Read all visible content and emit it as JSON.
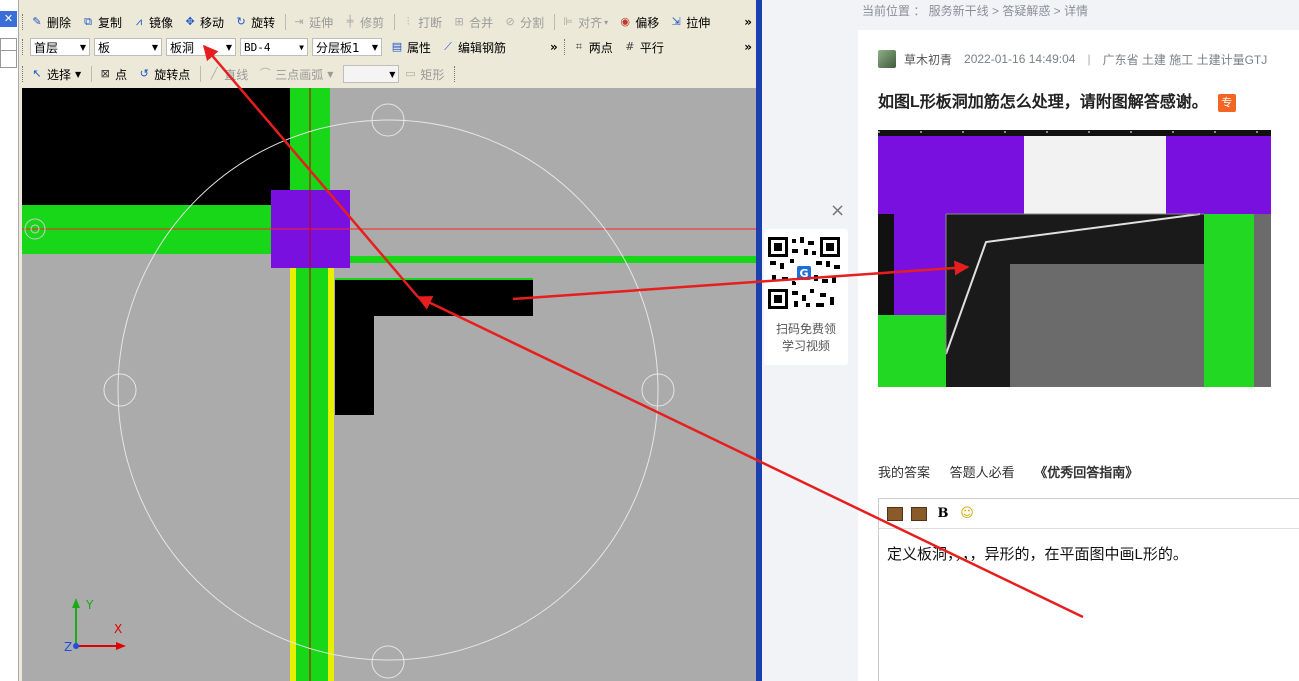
{
  "cad": {
    "toolbar1": {
      "delete": "删除",
      "copy": "复制",
      "mirror": "镜像",
      "move": "移动",
      "rotate": "旋转",
      "extend": "延伸",
      "trim": "修剪",
      "break": "打断",
      "merge": "合并",
      "split": "分割",
      "align": "对齐",
      "offset": "偏移",
      "stretch": "拉伸",
      "more": "»"
    },
    "toolbar2": {
      "floor": "首层",
      "category": "板",
      "component": "板洞",
      "code": "BD-4",
      "layer": "分层板1",
      "properties": "属性",
      "edit_rebar": "编辑钢筋",
      "more": "»",
      "two_point": "两点",
      "parallel": "平行",
      "more2": "»"
    },
    "toolbar3": {
      "select": "选择",
      "point": "点",
      "rotate_point": "旋转点",
      "line": "直线",
      "arc": "三点画弧",
      "rect": "矩形"
    },
    "axis": {
      "y": "Y",
      "x": "X",
      "z": "Z"
    },
    "close_icon": "✕"
  },
  "web": {
    "breadcrumb": "当前位置 ： 服务新干线 > 答疑解惑 > 详情",
    "author": "草木初青",
    "timestamp": "2022-01-16 14:49:04",
    "divider": "|",
    "tags": "广东省  土建 施工 土建计量GTJ",
    "question_title": "如图L形板洞加筋怎么处理，请附图解答感谢。",
    "badge": "专",
    "qr_label_line1": "扫码免费领",
    "qr_label_line2": "学习视频",
    "qr_close": "×",
    "tab_my_answer": "我的答案",
    "tab_must_read": "答题人必看",
    "guide_link": "《优秀回答指南》",
    "editor_bold": "B",
    "answer_text": "定义板洞，，，，异形的，在平面图中画L形的。"
  },
  "colors": {
    "cad_background": "#ababab",
    "green": "#18d618",
    "purple": "#7a10e0",
    "yellow": "#e8f000",
    "annotation_red": "#e61e1e",
    "badge_orange": "#f26522"
  }
}
